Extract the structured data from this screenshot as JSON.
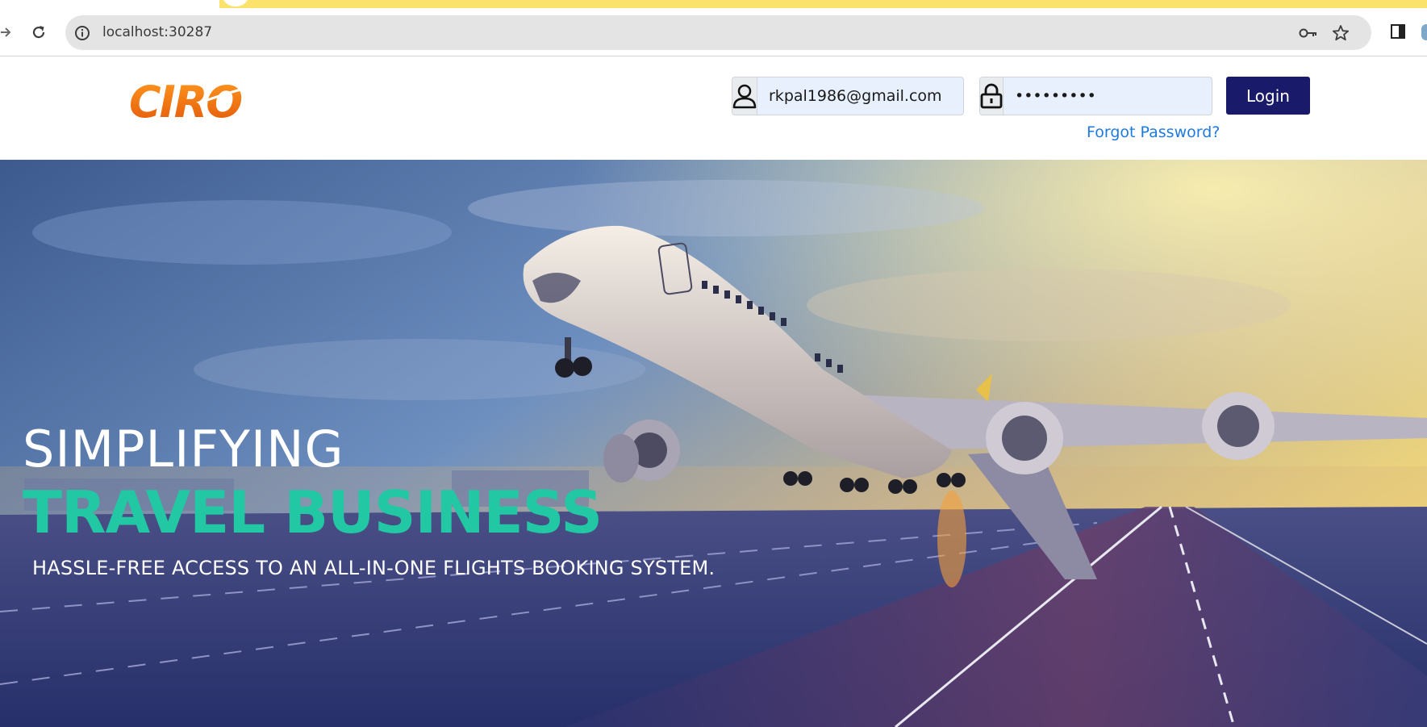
{
  "browser": {
    "url": "localhost:30287"
  },
  "header": {
    "logo_text": "CIRO",
    "email_value": "rkpal1986@gmail.com",
    "password_value": "•••••••••",
    "login_label": "Login",
    "forgot_label": "Forgot Password?"
  },
  "hero": {
    "line1": "SIMPLIFYING",
    "line2": "TRAVEL BUSINESS",
    "line3": "HASSLE-FREE ACCESS TO AN ALL-IN-ONE FLIGHTS BOOKING SYSTEM."
  },
  "colors": {
    "brand_orange": "#f07a10",
    "login_button": "#1a1a6b",
    "link_blue": "#1f7ae0",
    "headline_teal": "#22c7a4"
  },
  "icons": [
    "back-arrow-icon",
    "reload-icon",
    "site-info-icon",
    "key-icon",
    "star-icon",
    "side-panel-icon",
    "user-icon",
    "lock-icon"
  ]
}
